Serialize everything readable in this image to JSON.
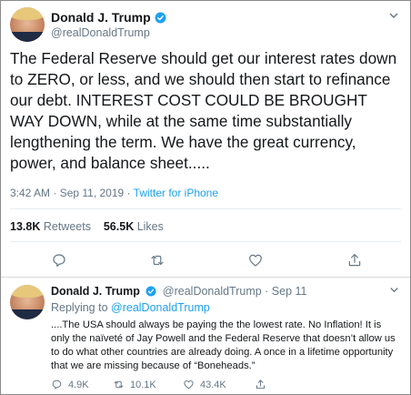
{
  "main_tweet": {
    "name": "Donald J. Trump",
    "handle": "@realDonaldTrump",
    "text": "The Federal Reserve should get our interest rates down to ZERO, or less, and we should then start to refinance our debt. INTEREST COST COULD BE BROUGHT WAY DOWN, while at the same time substantially lengthening the term. We have the great currency, power, and balance sheet.....",
    "time": "3:42 AM · Sep 11, 2019 · ",
    "source": "Twitter for iPhone",
    "retweets_count": "13.8K",
    "retweets_label": "Retweets",
    "likes_count": "56.5K",
    "likes_label": "Likes"
  },
  "reply_tweet": {
    "name": "Donald J. Trump",
    "handle_date": "@realDonaldTrump · Sep 11",
    "replying_prefix": "Replying to ",
    "replying_to": "@realDonaldTrump",
    "text": "....The USA should always be paying the the lowest rate. No Inflation! It is only the naïveté of Jay Powell and the Federal Reserve that doesn’t allow us to do what other countries are already doing. A once in a lifetime opportunity that we are missing because of “Boneheads.”",
    "reply_count": "4.9K",
    "retweet_count": "10.1K",
    "like_count": "43.4K"
  },
  "colors": {
    "accent": "#1da1f2",
    "muted": "#657786",
    "text": "#14171a"
  },
  "icons": [
    "verified-badge-icon",
    "chevron-down-icon",
    "reply-icon",
    "retweet-icon",
    "like-icon",
    "share-icon"
  ]
}
